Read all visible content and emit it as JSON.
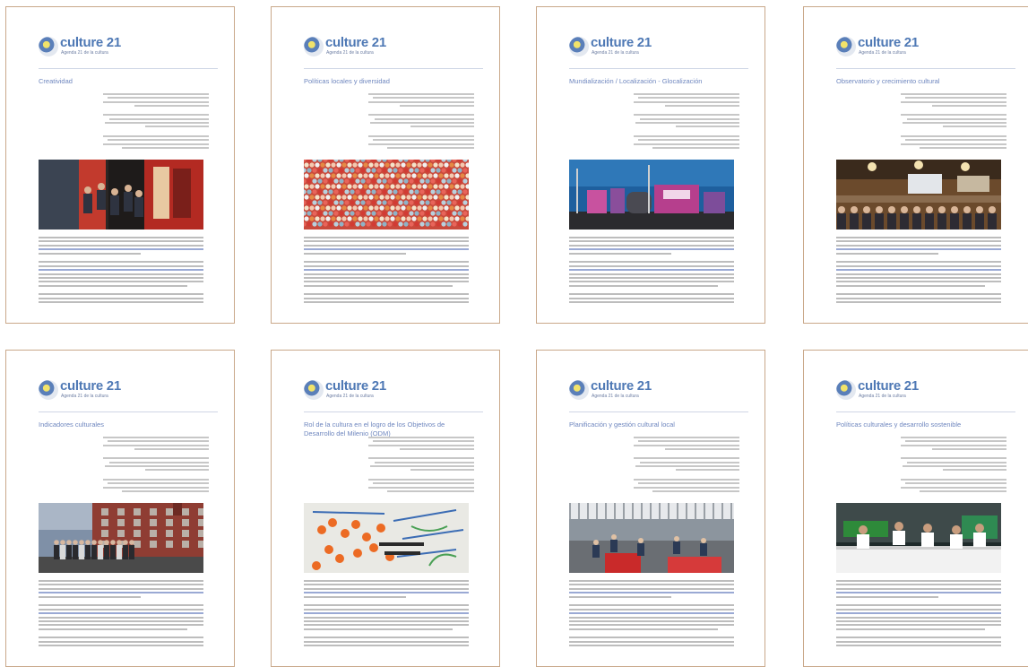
{
  "logo": {
    "brand": "culture 21",
    "tagline": "Agenda 21 de la cultura"
  },
  "pages": [
    {
      "title": "Creatividad"
    },
    {
      "title": "Políticas locales y diversidad"
    },
    {
      "title": "Mundialización / Localización - Glocalización"
    },
    {
      "title": "Observatorio y crecimiento cultural"
    },
    {
      "title": "Indicadores culturales"
    },
    {
      "title": "Rol de la cultura en el logro de los Objetivos de Desarrollo del Milenio (ODM)"
    },
    {
      "title": "Planificación y gestión cultural local"
    },
    {
      "title": "Políticas culturales y desarrollo sostenible"
    }
  ],
  "colors": {
    "accent": "#4f79b5",
    "title": "#6f87bf",
    "border": "#c9a88a"
  }
}
